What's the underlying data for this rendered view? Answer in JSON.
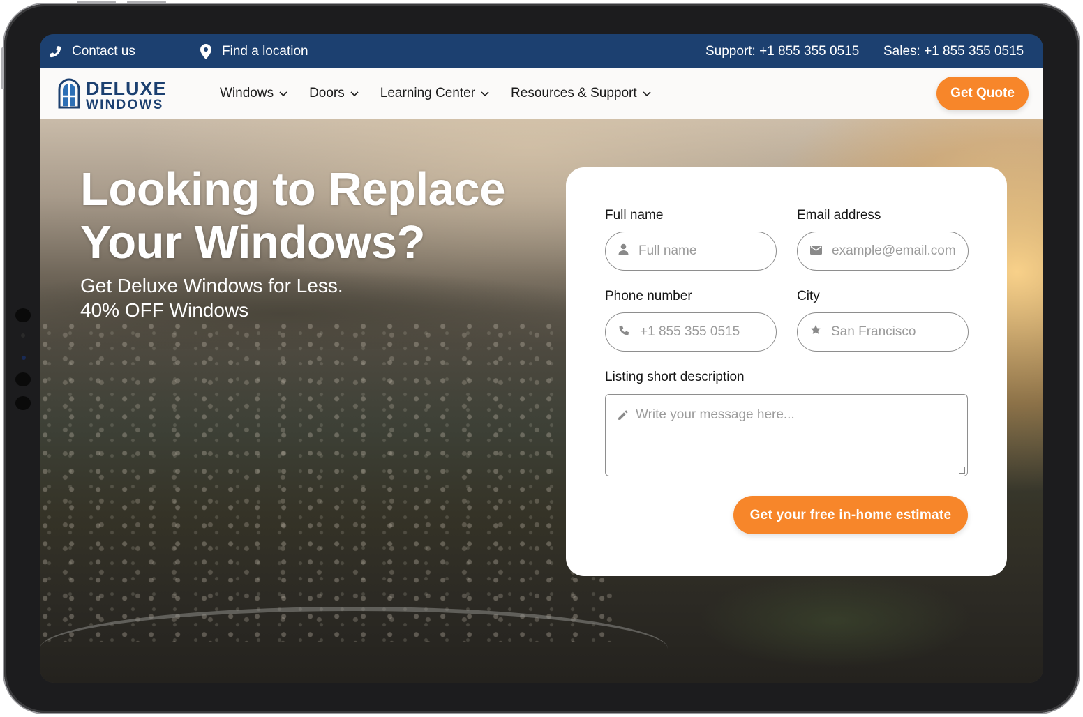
{
  "topbar": {
    "contact_label": "Contact us",
    "location_label": "Find a location",
    "support_text": "Support: +1 855 355 0515",
    "sales_text": "Sales: +1 855 355 0515"
  },
  "logo": {
    "line1": "DELUXE",
    "line2": "WINDOWS"
  },
  "nav": {
    "items": [
      {
        "label": "Windows"
      },
      {
        "label": "Doors"
      },
      {
        "label": "Learning Center"
      },
      {
        "label": "Resources & Support"
      }
    ],
    "quote_label": "Get Quote"
  },
  "hero": {
    "headline_line1": "Looking to Replace",
    "headline_line2": "Your Windows?",
    "sub_line1": "Get Deluxe Windows for Less.",
    "sub_line2": "40% OFF Windows"
  },
  "form": {
    "full_name": {
      "label": "Full name",
      "placeholder": "Full name"
    },
    "email": {
      "label": "Email address",
      "placeholder": "example@email.com"
    },
    "phone": {
      "label": "Phone number",
      "placeholder": "+1 855 355 0515"
    },
    "city": {
      "label": "City",
      "placeholder": "San Francisco"
    },
    "description": {
      "label": "Listing short description",
      "placeholder": "Write your message here..."
    },
    "submit_label": "Get your free in-home estimate"
  },
  "colors": {
    "brand_blue": "#1c4070",
    "accent_orange": "#f7862a"
  },
  "icons": {
    "contact": "phone-icon",
    "location": "map-pin-icon",
    "name_field": "user-icon",
    "email_field": "envelope-icon",
    "phone_field": "phone-icon",
    "city_field": "star-icon",
    "description_field": "pencil-icon",
    "dropdown": "chevron-down-icon"
  }
}
